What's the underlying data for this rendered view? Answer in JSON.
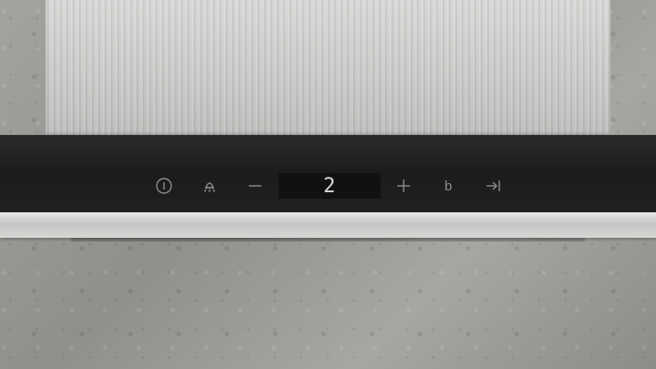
{
  "hood": {
    "fan_level": "2",
    "boost_label": "b"
  },
  "controls": [
    {
      "name": "power",
      "icon": "power-icon"
    },
    {
      "name": "light",
      "icon": "lamp-icon"
    },
    {
      "name": "decrease",
      "icon": "minus-icon"
    },
    {
      "name": "increase",
      "icon": "plus-icon"
    },
    {
      "name": "boost",
      "icon": "boost-icon"
    },
    {
      "name": "run-on",
      "icon": "run-on-arrow-icon"
    }
  ],
  "colors": {
    "panel": "#1c1c1c",
    "display_bg": "#111111",
    "icon": "#8c8c8c",
    "digit": "#d8d8d8"
  }
}
